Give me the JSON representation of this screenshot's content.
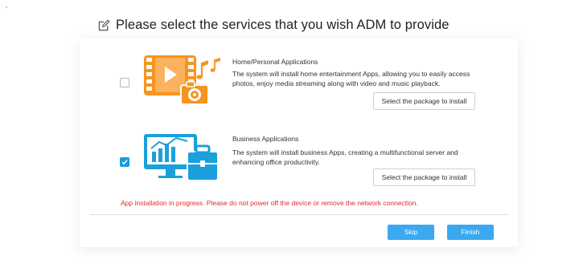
{
  "header": {
    "title": "Please select the services that you wish ADM to provide",
    "icon": "edit-icon"
  },
  "services": [
    {
      "title": "Home/Personal Applications",
      "description": "The system will install home entertainment Apps, allowing you to easily access photos, enjoy media streaming along with video and music playback.",
      "checked": false,
      "button_label": "Select the package to install",
      "icon": "media-apps-icon"
    },
    {
      "title": "Business Applications",
      "description": "The system will install business Apps, creating a multifunctional server and enhancing office productivity.",
      "checked": true,
      "button_label": "Select the package to install",
      "icon": "business-apps-icon"
    }
  ],
  "warning": "App installation in progress. Please do not power off the device or remove the network connection.",
  "actions": {
    "skip_label": "Skip",
    "finish_label": "Finish"
  },
  "colors": {
    "accent": "#3ba8ef",
    "checkbox": "#1b9ae0",
    "warning": "#e02b2b",
    "home_illustration": "#f7941d",
    "business_illustration": "#1aa0dc"
  }
}
